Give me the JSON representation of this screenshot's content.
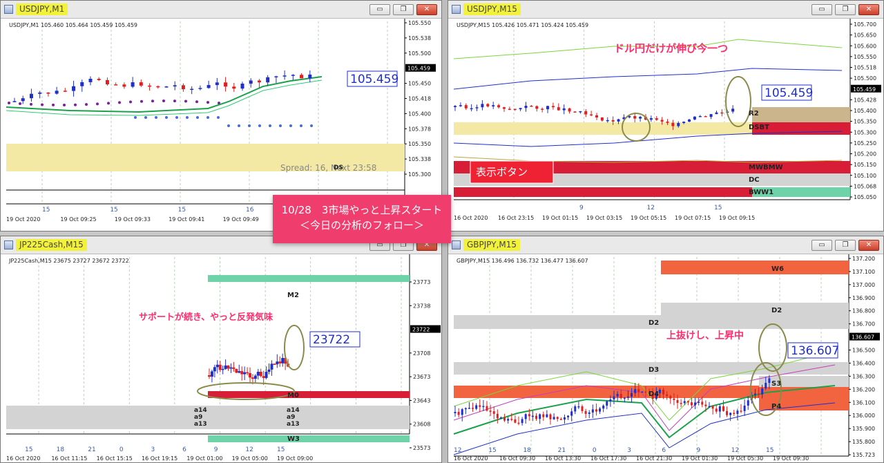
{
  "colors": {
    "titleHighlight": "#f2f23a",
    "bull": "#1f2fc9",
    "bear": "#e02020",
    "annotation": "#ff2d6e",
    "overlayBg": "#ef3d6e",
    "zoneRed": "#d81e36",
    "zoneGrey": "#d3d3d3",
    "zoneYellow": "#f3e9a4",
    "zoneGreen": "#6fd3a9",
    "zoneOrange": "#f26440",
    "zoneTan": "#cbb58c"
  },
  "window_buttons": {
    "minimize": "▭",
    "restore": "❐",
    "close": "✕"
  },
  "overlay": {
    "line1": "10/28　3市場やっと上昇スタート",
    "line2": "＜今日の分析のフォロー＞"
  },
  "windows": [
    {
      "title": "USDJPY,M1",
      "ohlc_text": "USDJPY,M1  105.460 105.464 105.459 105.459",
      "price_labels": [
        "105.550",
        "105.538",
        "105.500",
        "105.459",
        "105.450",
        "105.418",
        "105.400",
        "105.378",
        "105.350",
        "105.338",
        "105.300"
      ],
      "current_price": "105.459",
      "price_callout": "105.459",
      "spread_text": "Spread: 16, Next 23:58",
      "zone_labels": [
        "DS"
      ],
      "time_labels": [
        "19 Oct 2020",
        "19 Oct 09:25",
        "19 Oct 09:33",
        "19 Oct 09:41",
        "19 Oct 09:49",
        "19 Oct 09:57"
      ],
      "small_time_labels": [
        "15",
        "15",
        "15",
        "16"
      ],
      "annotations": []
    },
    {
      "title": "USDJPY,M15",
      "ohlc_text": "USDJPY,M15  105.426 105.471 105.424 105.459",
      "price_labels": [
        "105.700",
        "105.650",
        "105.600",
        "105.550",
        "105.518",
        "105.500",
        "105.459",
        "105.428",
        "105.400",
        "105.350",
        "105.300",
        "105.250",
        "105.200",
        "105.150",
        "105.100",
        "105.068",
        "105.050"
      ],
      "current_price": "105.459",
      "price_callout": "105.459",
      "zone_labels": [
        "R2",
        "DSBT",
        "MWBMW",
        "DC",
        "BWW1"
      ],
      "annotations": [
        "ドル円だけが伸び今一つ"
      ],
      "display_button": "表示ボタン",
      "time_labels": [
        "16 Oct 2020",
        "16 Oct 23:15",
        "19 Oct 01:15",
        "19 Oct 03:15",
        "19 Oct 05:15",
        "19 Oct 07:15",
        "19 Oct 09:15"
      ],
      "small_time_labels": [
        "9",
        "12",
        "15"
      ]
    },
    {
      "title": "JP225Cash,M15",
      "ohlc_text": "JP225Cash,M15  23675 23727 23672 23722",
      "price_labels": [
        "23773",
        "23738",
        "23722",
        "23708",
        "23673",
        "23643",
        "23608",
        "23573"
      ],
      "current_price": "23722",
      "price_callout": "23722",
      "zone_labels": [
        "M2",
        "M0",
        "W3"
      ],
      "annotations": [
        "サポートが続き、やっと反発気味"
      ],
      "left_stack": [
        "a14",
        "a9",
        "a13"
      ],
      "right_stack": [
        "a14",
        "a9",
        "a13"
      ],
      "time_labels": [
        "16 Oct 2020",
        "16 Oct 11:15",
        "16 Oct 15:15",
        "16 Oct 19:15",
        "19 Oct 01:00",
        "19 Oct 05:00",
        "19 Oct 09:00"
      ],
      "small_time_labels": [
        "15",
        "18",
        "21",
        "0",
        "3",
        "6",
        "9",
        "12",
        "15"
      ]
    },
    {
      "title": "GBPJPY,M15",
      "ohlc_text": "GBPJPY,M15  136.496 136.732 136.477 136.607",
      "price_labels": [
        "137.200",
        "137.100",
        "137.000",
        "136.900",
        "136.800",
        "136.700",
        "136.607",
        "136.500",
        "136.400",
        "136.300",
        "136.200",
        "136.100",
        "136.000",
        "135.900",
        "135.800",
        "135.723"
      ],
      "current_price": "136.607",
      "price_callout": "136.607",
      "zone_labels": [
        "W6",
        "D2",
        "D2",
        "D3",
        "D4",
        "S3",
        "P4"
      ],
      "annotations": [
        "上抜けし、上昇中"
      ],
      "time_labels": [
        "16 Oct 2020",
        "16 Oct 09:30",
        "16 Oct 13:30",
        "16 Oct 17:30",
        "16 Oct 21:30",
        "19 Oct 01:30",
        "19 Oct 05:30",
        "19 Oct 09:30"
      ],
      "small_time_labels": [
        "12",
        "15",
        "18",
        "21",
        "0",
        "3",
        "6",
        "9",
        "12",
        "15"
      ]
    }
  ]
}
